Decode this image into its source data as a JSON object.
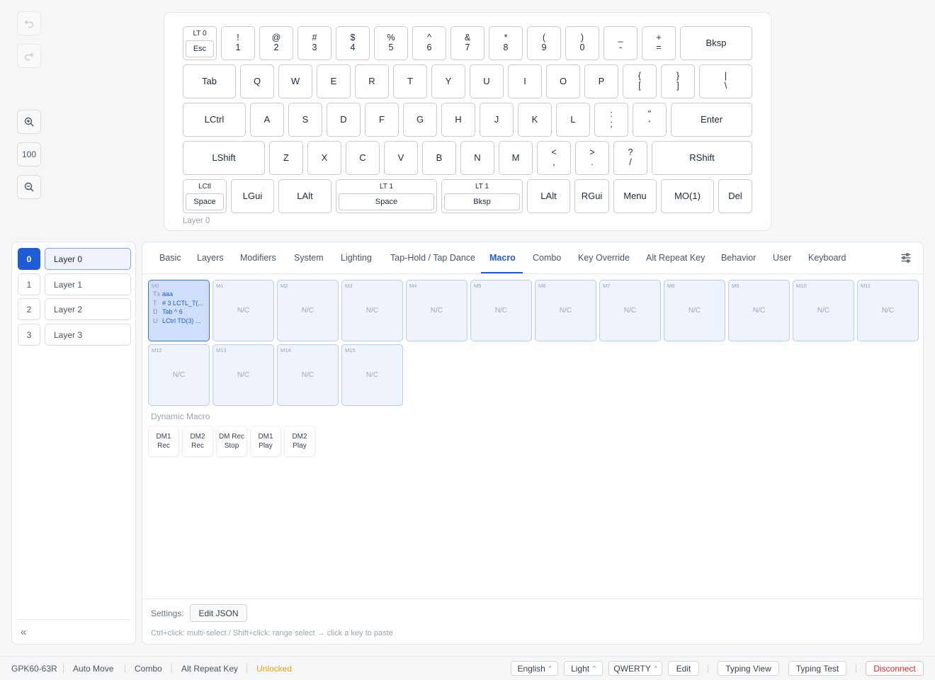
{
  "tools": {
    "zoom_level": "100"
  },
  "keyboard": {
    "layer_caption": "Layer 0",
    "rows": [
      [
        {
          "type": "lt",
          "top": "LT 0",
          "label": "Esc"
        },
        {
          "top": "!",
          "label": "1"
        },
        {
          "top": "@",
          "label": "2"
        },
        {
          "top": "#",
          "label": "3"
        },
        {
          "top": "$",
          "label": "4"
        },
        {
          "top": "%",
          "label": "5"
        },
        {
          "top": "^",
          "label": "6"
        },
        {
          "top": "&",
          "label": "7"
        },
        {
          "top": "*",
          "label": "8"
        },
        {
          "top": "(",
          "label": "9"
        },
        {
          "top": ")",
          "label": "0"
        },
        {
          "top": "_",
          "label": "-"
        },
        {
          "top": "+",
          "label": "="
        },
        {
          "label": "Bksp"
        }
      ],
      [
        {
          "label": "Tab"
        },
        {
          "label": "Q"
        },
        {
          "label": "W"
        },
        {
          "label": "E"
        },
        {
          "label": "R"
        },
        {
          "label": "T"
        },
        {
          "label": "Y"
        },
        {
          "label": "U"
        },
        {
          "label": "I"
        },
        {
          "label": "O"
        },
        {
          "label": "P"
        },
        {
          "top": "{",
          "label": "["
        },
        {
          "top": "}",
          "label": "]"
        },
        {
          "top": "|",
          "label": "\\"
        }
      ],
      [
        {
          "label": "LCtrl"
        },
        {
          "label": "A"
        },
        {
          "label": "S"
        },
        {
          "label": "D"
        },
        {
          "label": "F"
        },
        {
          "label": "G"
        },
        {
          "label": "H"
        },
        {
          "label": "J"
        },
        {
          "label": "K"
        },
        {
          "label": "L"
        },
        {
          "top": ":",
          "label": ";"
        },
        {
          "top": "\"",
          "label": "'"
        },
        {
          "label": "Enter"
        }
      ],
      [
        {
          "label": "LShift"
        },
        {
          "label": "Z"
        },
        {
          "label": "X"
        },
        {
          "label": "C"
        },
        {
          "label": "V"
        },
        {
          "label": "B"
        },
        {
          "label": "N"
        },
        {
          "label": "M"
        },
        {
          "top": "<",
          "label": ","
        },
        {
          "top": ">",
          "label": "."
        },
        {
          "top": "?",
          "label": "/"
        },
        {
          "label": "RShift"
        }
      ],
      [
        {
          "type": "lt",
          "top": "LCtl",
          "label": "Space"
        },
        {
          "label": "LGui"
        },
        {
          "label": "LAlt"
        },
        {
          "type": "lt",
          "top": "LT 1",
          "label": "Space"
        },
        {
          "type": "lt",
          "top": "LT 1",
          "label": "Bksp"
        },
        {
          "label": "LAlt"
        },
        {
          "label": "RGui"
        },
        {
          "label": "Menu"
        },
        {
          "label": "MO(1)"
        },
        {
          "label": "Del"
        }
      ]
    ]
  },
  "layers": [
    {
      "num": "0",
      "name": "Layer 0",
      "active": true
    },
    {
      "num": "1",
      "name": "Layer 1",
      "active": false
    },
    {
      "num": "2",
      "name": "Layer 2",
      "active": false
    },
    {
      "num": "3",
      "name": "Layer 3",
      "active": false
    }
  ],
  "collapse_label": "«",
  "tabs": [
    {
      "label": "Basic"
    },
    {
      "label": "Layers"
    },
    {
      "label": "Modifiers"
    },
    {
      "label": "System"
    },
    {
      "label": "Lighting"
    },
    {
      "label": "Tap-Hold / Tap Dance"
    },
    {
      "label": "Macro",
      "active": true
    },
    {
      "label": "Combo"
    },
    {
      "label": "Key Override"
    },
    {
      "label": "Alt Repeat Key"
    },
    {
      "label": "Behavior"
    },
    {
      "label": "User"
    },
    {
      "label": "Keyboard"
    }
  ],
  "macros": [
    {
      "id": "M0",
      "lines": [
        {
          "t": "Tx",
          "v": "aaa"
        },
        {
          "t": "T",
          "v": "# 3 LCTL_T(..."
        },
        {
          "t": "D",
          "v": "Tab ^ 6"
        },
        {
          "t": "U",
          "v": "LCtrl TD(3) ..."
        }
      ],
      "selected": true
    },
    {
      "id": "M1",
      "value": "N/C"
    },
    {
      "id": "M2",
      "value": "N/C"
    },
    {
      "id": "M3",
      "value": "N/C"
    },
    {
      "id": "M4",
      "value": "N/C"
    },
    {
      "id": "M5",
      "value": "N/C"
    },
    {
      "id": "M6",
      "value": "N/C"
    },
    {
      "id": "M7",
      "value": "N/C"
    },
    {
      "id": "M8",
      "value": "N/C"
    },
    {
      "id": "M9",
      "value": "N/C"
    },
    {
      "id": "M10",
      "value": "N/C"
    },
    {
      "id": "M11",
      "value": "N/C"
    },
    {
      "id": "M12",
      "value": "N/C"
    },
    {
      "id": "M13",
      "value": "N/C"
    },
    {
      "id": "M14",
      "value": "N/C"
    },
    {
      "id": "M15",
      "value": "N/C"
    }
  ],
  "dynamic_macro": {
    "label": "Dynamic Macro",
    "buttons": [
      {
        "l1": "DM1",
        "l2": "Rec"
      },
      {
        "l1": "DM2",
        "l2": "Rec"
      },
      {
        "l1": "DM Rec",
        "l2": "Stop"
      },
      {
        "l1": "DM1",
        "l2": "Play"
      },
      {
        "l1": "DM2",
        "l2": "Play"
      }
    ]
  },
  "settings": {
    "label": "Settings:",
    "edit_json": "Edit JSON",
    "hint": "Ctrl+click: multi-select / Shift+click: range select → click a key to paste"
  },
  "status": {
    "device": "GPK60-63R",
    "auto_move": "Auto Move",
    "combo": "Combo",
    "alt_repeat": "Alt Repeat Key",
    "lock_state": "Unlocked",
    "language": "English",
    "theme": "Light",
    "layout": "QWERTY",
    "edit": "Edit",
    "typing_view": "Typing View",
    "typing_test": "Typing Test",
    "disconnect": "Disconnect",
    "colors": {
      "accent": "#1e5bd6",
      "warn": "#e8a317",
      "danger": "#dc2626"
    }
  }
}
